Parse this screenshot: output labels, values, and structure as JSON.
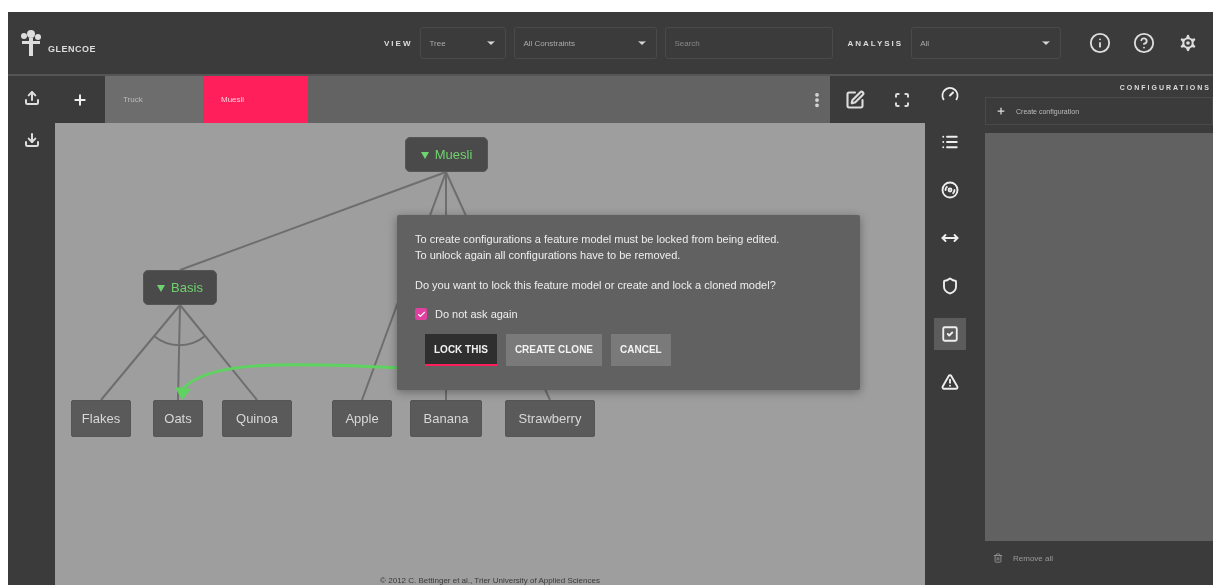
{
  "header": {
    "logo": "GLENCOE",
    "view_label": "VIEW",
    "view_select": "Tree",
    "constraints_select": "All Constraints",
    "search": {
      "placeholder": "Search"
    },
    "analysis_label": "ANALYSIS",
    "analysis_select": "All"
  },
  "tabs": [
    {
      "label": "Truck",
      "selected": false
    },
    {
      "label": "Muesli",
      "selected": true
    }
  ],
  "diagram": {
    "root": {
      "label": "Muesli",
      "kind": "abstract",
      "children": [
        {
          "label": "Basis",
          "kind": "abstract",
          "children": [
            {
              "label": "Flakes",
              "kind": "concrete"
            },
            {
              "label": "Oats",
              "kind": "concrete"
            },
            {
              "label": "Quinoa",
              "kind": "concrete"
            }
          ]
        },
        {
          "label": "Apple",
          "kind": "concrete"
        },
        {
          "label": "Banana",
          "kind": "concrete"
        },
        {
          "label": "Strawberry",
          "kind": "concrete"
        }
      ]
    }
  },
  "dialog": {
    "lines": [
      "To create configurations a feature model must be locked from being edited.",
      "To unlock again all configurations have to be removed."
    ],
    "question": "Do you want to lock this feature model or create and lock a cloned model?",
    "checkbox": {
      "label": "Do not ask again",
      "checked": true
    },
    "buttons": [
      {
        "label": "LOCK THIS",
        "focused": true
      },
      {
        "label": "CREATE CLONE",
        "focused": false
      },
      {
        "label": "CANCEL",
        "focused": false
      }
    ]
  },
  "tools": [
    {
      "kind": "gauge",
      "selected": false
    },
    {
      "kind": "list",
      "selected": false
    },
    {
      "kind": "circle",
      "selected": false
    },
    {
      "kind": "arrows",
      "selected": false
    },
    {
      "kind": "shield",
      "selected": false
    },
    {
      "kind": "check",
      "selected": true
    },
    {
      "kind": "warning",
      "selected": false
    }
  ],
  "configurations": {
    "title": "CONFIGURATIONS",
    "create_button": "Create configuration",
    "remove_button": "Remove all"
  },
  "footer": "© 2012 C. Bettinger et al., Trier University of Applied Sciences"
}
